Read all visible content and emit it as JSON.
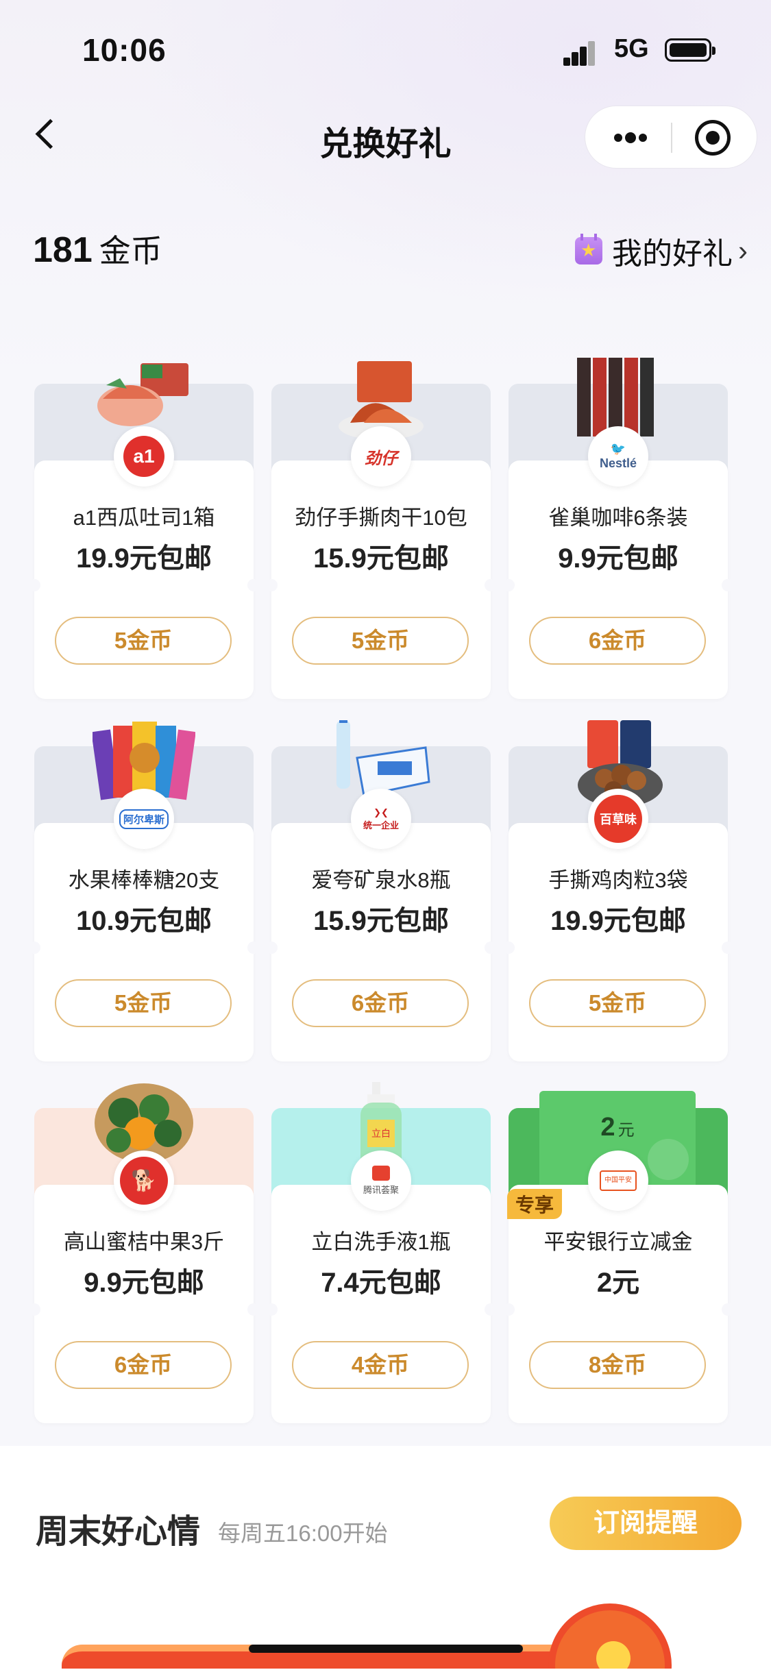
{
  "status_bar": {
    "time": "10:06",
    "network": "5G"
  },
  "nav": {
    "title": "兑换好礼"
  },
  "account": {
    "coins": "181",
    "coin_unit": "金币",
    "my_gifts_label": "我的好礼"
  },
  "gifts": [
    {
      "name": "a1西瓜吐司1箱",
      "price": "19.9元包邮",
      "cost": "5金币",
      "logo": "a1",
      "top_color": "#e4e7ee"
    },
    {
      "name": "劲仔手撕肉干10包",
      "price": "15.9元包邮",
      "cost": "5金币",
      "logo": "劲仔",
      "top_color": "#e4e7ee"
    },
    {
      "name": "雀巢咖啡6条装",
      "price": "9.9元包邮",
      "cost": "6金币",
      "logo": "Nestlé",
      "top_color": "#e4e7ee"
    },
    {
      "name": "水果棒棒糖20支",
      "price": "10.9元包邮",
      "cost": "5金币",
      "logo": "阿尔卑斯",
      "top_color": "#e4e7ee"
    },
    {
      "name": "爱夸矿泉水8瓶",
      "price": "15.9元包邮",
      "cost": "6金币",
      "logo": "统一企业",
      "top_color": "#e4e7ee"
    },
    {
      "name": "手撕鸡肉粒3袋",
      "price": "19.9元包邮",
      "cost": "5金币",
      "logo": "百草味",
      "top_color": "#e4e7ee"
    },
    {
      "name": "高山蜜桔中果3斤",
      "price": "9.9元包邮",
      "cost": "6金币",
      "logo": "JD",
      "top_color": "#fbe6dd"
    },
    {
      "name": "立白洗手液1瓶",
      "price": "7.4元包邮",
      "cost": "4金币",
      "logo": "腾讯荟聚",
      "top_color": "#b5f0ec"
    },
    {
      "name": "平安银行立减金",
      "price": "2元",
      "cost": "8金币",
      "logo": "中国平安",
      "top_color": "#4cb85c",
      "badge": "专享",
      "voucher_amount": "2",
      "voucher_unit": "元"
    }
  ],
  "weekend": {
    "title": "周末好心情",
    "subtitle": "每周五16:00开始",
    "subscribe_label": "订阅提醒"
  }
}
